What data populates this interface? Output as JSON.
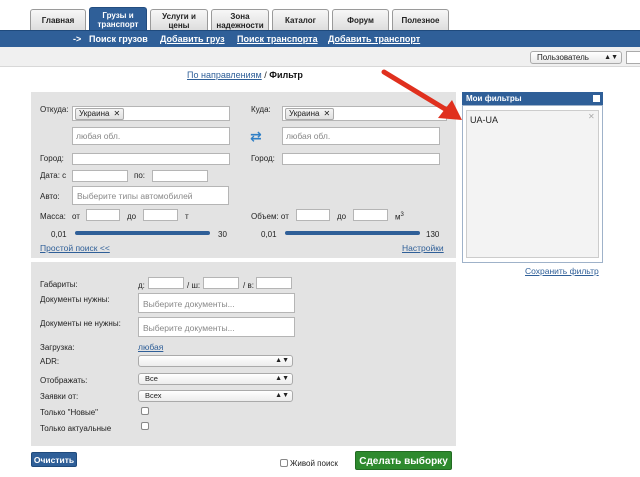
{
  "tabs": [
    {
      "label": "Главная"
    },
    {
      "label": "Грузы и транспорт"
    },
    {
      "label": "Услуги и цены"
    },
    {
      "label": "Зона надежности"
    },
    {
      "label": "Каталог"
    },
    {
      "label": "Форум"
    },
    {
      "label": "Полезное"
    }
  ],
  "subnav": {
    "arrow": "->",
    "items": [
      "Поиск грузов",
      "Добавить груз",
      "Поиск транспорта",
      "Добавить транспорт"
    ]
  },
  "user_select": {
    "value": "Пользователь",
    "arrow": "▲▼"
  },
  "breadcrumb": {
    "link": "По направлениям",
    "sep": "/",
    "current": "Фильтр"
  },
  "form": {
    "from_label": "Откуда:",
    "from_chip": "Украина",
    "from_region_placeholder": "любая обл.",
    "to_label": "Куда:",
    "to_chip": "Украина",
    "to_region_placeholder": "любая обл.",
    "swap_icon": "⇄",
    "city_from_label": "Город:",
    "city_to_label": "Город:",
    "date_from_label": "Дата: с",
    "date_to_label": "по:",
    "auto_label": "Авто:",
    "auto_placeholder": "Выберите типы автомобилей",
    "mass_label": "Масса:",
    "mass_from": "от",
    "mass_to": "до",
    "mass_unit": "т",
    "mass_min": "0,01",
    "mass_max": "30",
    "volume_label": "Объем: от",
    "volume_to": "до",
    "volume_unit": "м",
    "volume_sup": "3",
    "volume_min": "0,01",
    "volume_max": "130",
    "simple_search": "Простой поиск <<",
    "settings": "Настройки",
    "dims_label": "Габариты:",
    "dim_d": "д:",
    "dim_sh": "/ ш:",
    "dim_v": "/ в:",
    "docs_required_label": "Документы нужны:",
    "docs_required_placeholder": "Выберите документы...",
    "docs_not_required_label": "Документы не нужны:",
    "docs_not_required_placeholder": "Выберите документы...",
    "loading_label": "Загрузка:",
    "loading_value": "любая",
    "adr_label": "ADR:",
    "adr_value": "",
    "display_label": "Отображать:",
    "display_value": "Все",
    "requests_label": "Заявки от:",
    "requests_value": "Всех",
    "only_new_label": "Только  \"Новые\"",
    "only_actual_label": "Только актуальные",
    "select_arrow": "▲▼"
  },
  "filters": {
    "title": "Мои фильтры",
    "items": [
      {
        "label": "UA-UA"
      }
    ],
    "save_link": "Сохранить фильтр",
    "delete_icon": "✕"
  },
  "bottom": {
    "clear_button": "Очистить",
    "live_search_label": "Живой поиск",
    "apply_button": "Сделать выборку"
  },
  "colors": {
    "brand_blue": "#2f5f98",
    "apply_green": "#2e8a2e",
    "arrow_red": "#e0301e",
    "panel_gray": "#e3e3e3"
  }
}
